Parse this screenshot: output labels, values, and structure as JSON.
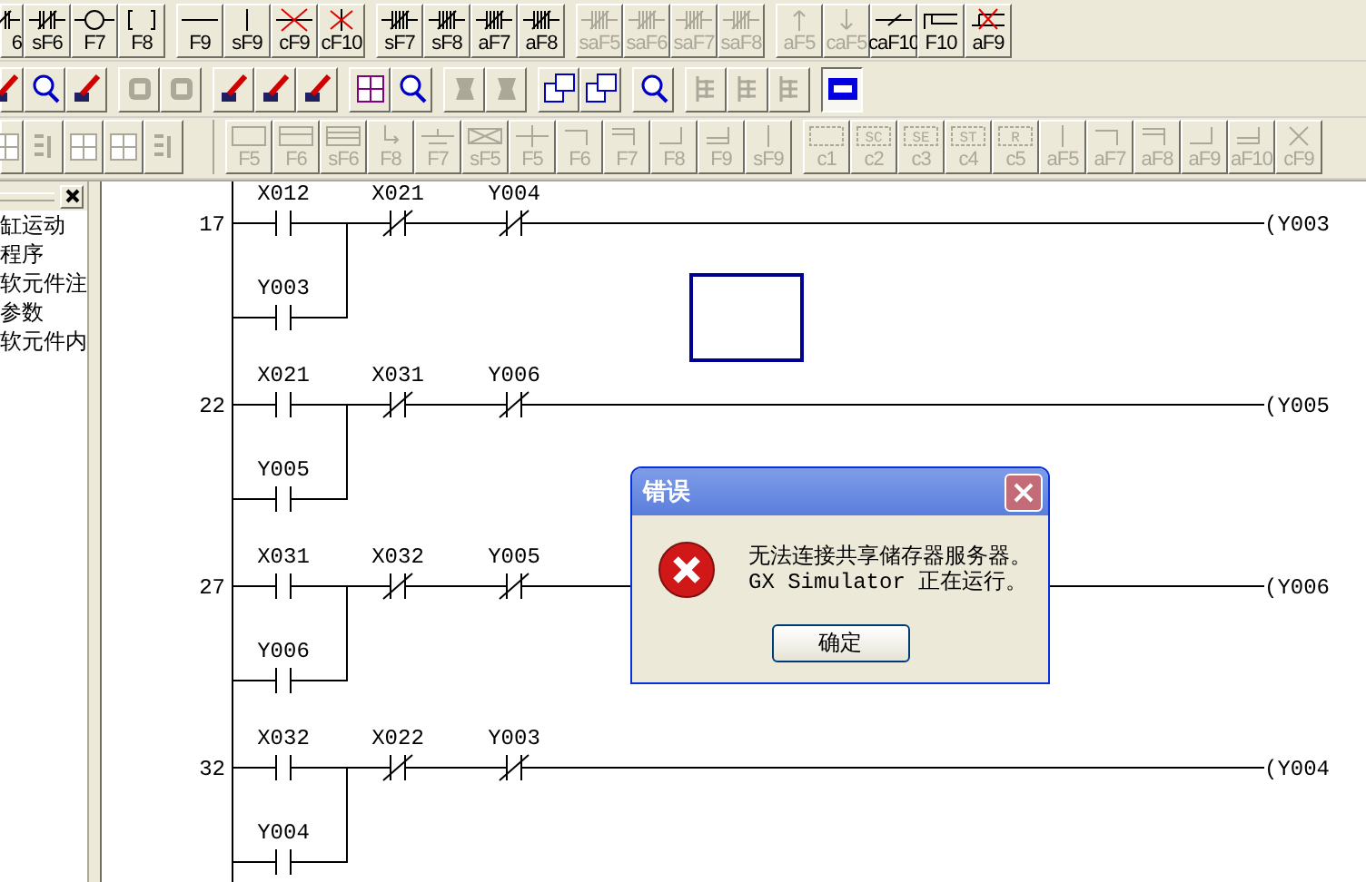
{
  "toolbar_rows": [
    {
      "groups": [
        [
          {
            "label": "6",
            "disabled": false
          },
          {
            "label": "sF6",
            "disabled": false
          },
          {
            "label": "F7",
            "disabled": false
          },
          {
            "label": "F8",
            "disabled": false
          }
        ],
        [
          {
            "label": "F9",
            "disabled": false
          },
          {
            "label": "sF9",
            "disabled": false
          },
          {
            "label": "cF9",
            "disabled": false
          },
          {
            "label": "cF10",
            "disabled": false
          }
        ],
        [
          {
            "label": "sF7",
            "disabled": false
          },
          {
            "label": "sF8",
            "disabled": false
          },
          {
            "label": "aF7",
            "disabled": false
          },
          {
            "label": "aF8",
            "disabled": false
          }
        ],
        [
          {
            "label": "saF5",
            "disabled": true
          },
          {
            "label": "saF6",
            "disabled": true
          },
          {
            "label": "saF7",
            "disabled": true
          },
          {
            "label": "saF8",
            "disabled": true
          }
        ],
        [
          {
            "label": "aF5",
            "disabled": true
          },
          {
            "label": "caF5",
            "disabled": true
          },
          {
            "label": "caF10",
            "disabled": false
          },
          {
            "label": "F10",
            "disabled": false
          },
          {
            "label": "aF9",
            "disabled": false
          }
        ]
      ]
    },
    {
      "groups": [
        [
          {
            "disabled": false,
            "pressed": false
          },
          {
            "disabled": false,
            "pressed": false
          },
          {
            "disabled": false,
            "pressed": false
          }
        ],
        [
          {
            "disabled": true,
            "pressed": false
          },
          {
            "disabled": true,
            "pressed": false
          }
        ],
        [
          {
            "disabled": false,
            "pressed": false
          },
          {
            "disabled": false,
            "pressed": false
          },
          {
            "disabled": false,
            "pressed": false
          }
        ],
        [
          {
            "disabled": false,
            "pressed": false
          },
          {
            "disabled": false,
            "pressed": false
          }
        ],
        [
          {
            "disabled": true,
            "pressed": false
          },
          {
            "disabled": true,
            "pressed": false
          }
        ],
        [
          {
            "disabled": false,
            "pressed": false
          },
          {
            "disabled": false,
            "pressed": false
          }
        ],
        [
          {
            "disabled": false,
            "pressed": false
          }
        ],
        [
          {
            "disabled": true,
            "pressed": false
          },
          {
            "disabled": true,
            "pressed": false
          },
          {
            "disabled": true,
            "pressed": false
          }
        ],
        [
          {
            "disabled": false,
            "pressed": true
          }
        ]
      ]
    },
    {
      "groups": [
        [
          {
            "disabled": true
          },
          {
            "disabled": true
          },
          {
            "disabled": true
          },
          {
            "disabled": true
          },
          {
            "disabled": true
          }
        ],
        [
          {
            "label": "F5",
            "disabled": true
          },
          {
            "label": "F6",
            "disabled": true
          },
          {
            "label": "sF6",
            "disabled": true
          },
          {
            "label": "F8",
            "disabled": true
          },
          {
            "label": "F7",
            "disabled": true
          },
          {
            "label": "sF5",
            "disabled": true
          },
          {
            "label": "F5",
            "disabled": true
          },
          {
            "label": "F6",
            "disabled": true
          },
          {
            "label": "F7",
            "disabled": true
          },
          {
            "label": "F8",
            "disabled": true
          },
          {
            "label": "F9",
            "disabled": true
          },
          {
            "label": "sF9",
            "disabled": true
          }
        ],
        [
          {
            "label": "c1",
            "disabled": true
          },
          {
            "label": "c2",
            "inner": "SC",
            "disabled": true
          },
          {
            "label": "c3",
            "inner": "SE",
            "disabled": true
          },
          {
            "label": "c4",
            "inner": "ST",
            "disabled": true
          },
          {
            "label": "c5",
            "inner": "R",
            "disabled": true
          },
          {
            "label": "aF5",
            "disabled": true
          },
          {
            "label": "aF7",
            "disabled": true
          },
          {
            "label": "aF8",
            "disabled": true
          },
          {
            "label": "aF9",
            "disabled": true
          },
          {
            "label": "aF10",
            "disabled": true
          },
          {
            "label": "cF9",
            "disabled": true
          }
        ]
      ]
    }
  ],
  "project_panel": {
    "items": [
      "缸运动",
      "程序",
      "软元件注",
      "参数",
      "软元件内"
    ]
  },
  "rungs": [
    {
      "step": "17",
      "contacts": [
        {
          "label": "X012",
          "kind": "no"
        },
        {
          "label": "X021",
          "kind": "nc"
        },
        {
          "label": "Y004",
          "kind": "nc"
        }
      ],
      "coil": "(Y003",
      "branch": {
        "label": "Y003",
        "kind": "no"
      }
    },
    {
      "step": "22",
      "contacts": [
        {
          "label": "X021",
          "kind": "no"
        },
        {
          "label": "X031",
          "kind": "nc"
        },
        {
          "label": "Y006",
          "kind": "nc"
        }
      ],
      "coil": "(Y005",
      "branch": {
        "label": "Y005",
        "kind": "no"
      }
    },
    {
      "step": "27",
      "contacts": [
        {
          "label": "X031",
          "kind": "no"
        },
        {
          "label": "X032",
          "kind": "nc"
        },
        {
          "label": "Y005",
          "kind": "nc"
        }
      ],
      "coil": "(Y006",
      "branch": {
        "label": "Y006",
        "kind": "no"
      }
    },
    {
      "step": "32",
      "contacts": [
        {
          "label": "X032",
          "kind": "no"
        },
        {
          "label": "X022",
          "kind": "nc"
        },
        {
          "label": "Y003",
          "kind": "nc"
        }
      ],
      "coil": "(Y004",
      "branch": {
        "label": "Y004",
        "kind": "no"
      }
    }
  ],
  "dialog": {
    "title": "错误",
    "message": [
      "无法连接共享储存器服务器。",
      "GX Simulator 正在运行。"
    ],
    "button": "确定"
  }
}
